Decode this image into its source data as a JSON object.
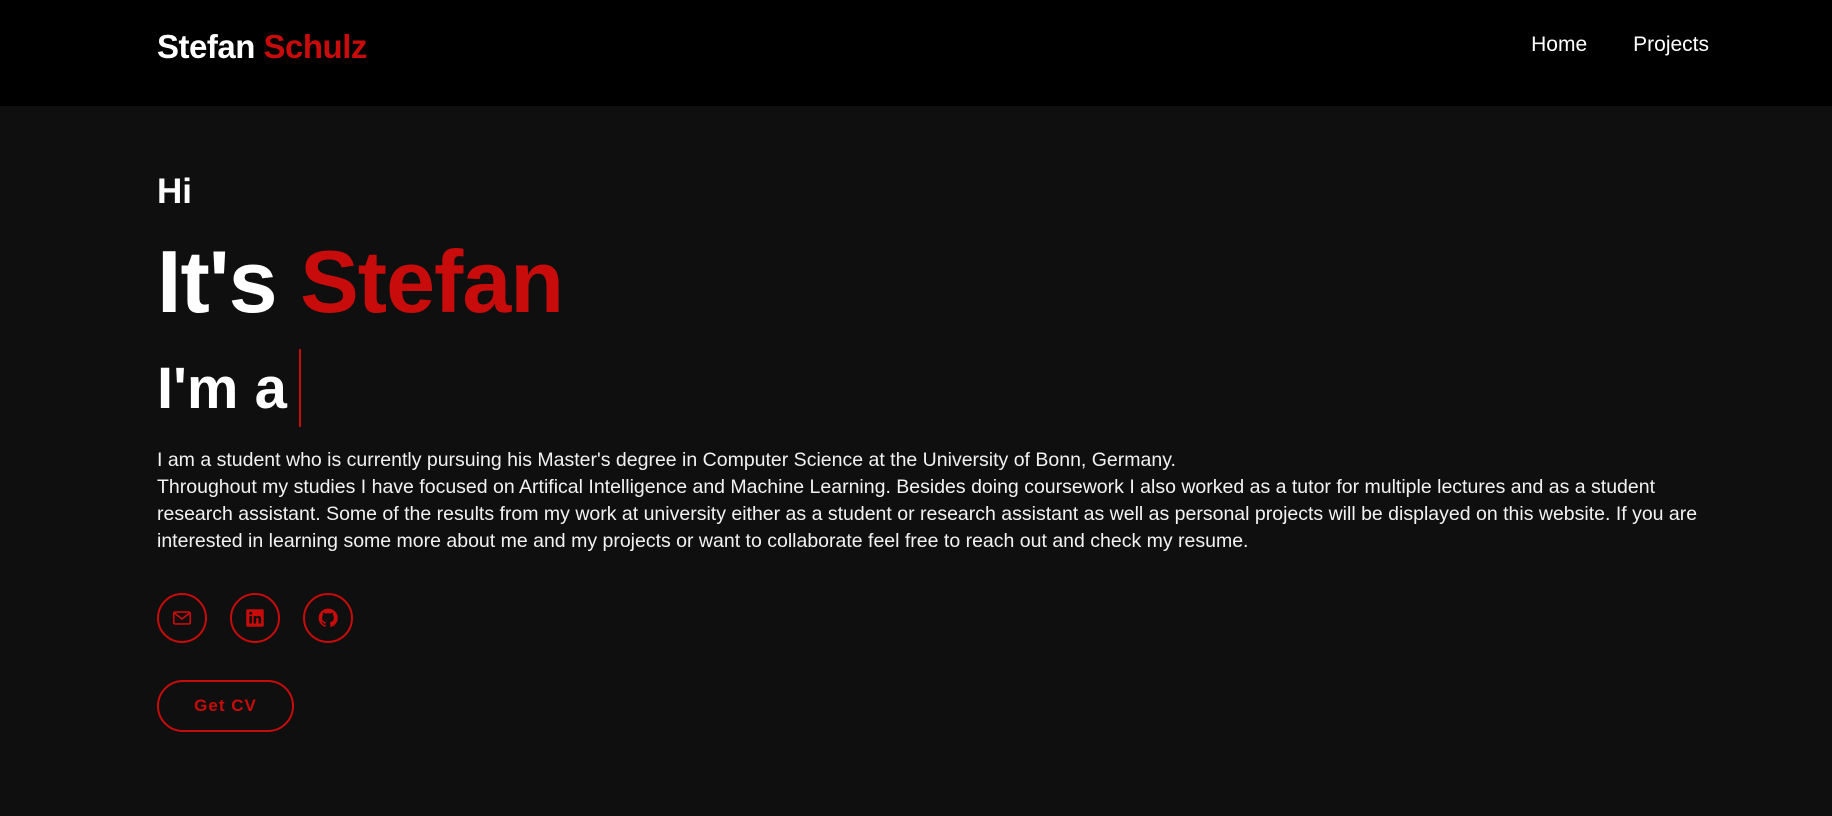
{
  "header": {
    "brand_first": "Stefan",
    "brand_last": "Schulz",
    "nav": [
      {
        "label": "Home"
      },
      {
        "label": "Projects"
      }
    ]
  },
  "hero": {
    "greeting": "Hi",
    "headline_prefix": "It's",
    "headline_name": "Stefan",
    "role_prefix": "I'm a",
    "bio_lines": [
      "I am a student who is currently pursuing his Master's degree in Computer Science at the University of Bonn, Germany.",
      "Throughout my studies I have focused on Artifical Intelligence and Machine Learning. Besides doing coursework I also worked as a tutor for multiple lectures and as a student research assistant. Some of the results from my work at university either as a student or research assistant as well as personal projects will be displayed on this website. If you are interested in learning some more about me and my projects or want to collaborate feel free to reach out and check my resume."
    ],
    "socials": [
      {
        "icon": "mail-icon"
      },
      {
        "icon": "linkedin-icon"
      },
      {
        "icon": "github-icon"
      }
    ],
    "cv_button": "Get CV"
  },
  "colors": {
    "accent": "#c80c0c",
    "header_bg": "#000000",
    "page_bg": "#0f0f0f",
    "text": "#ffffff"
  }
}
